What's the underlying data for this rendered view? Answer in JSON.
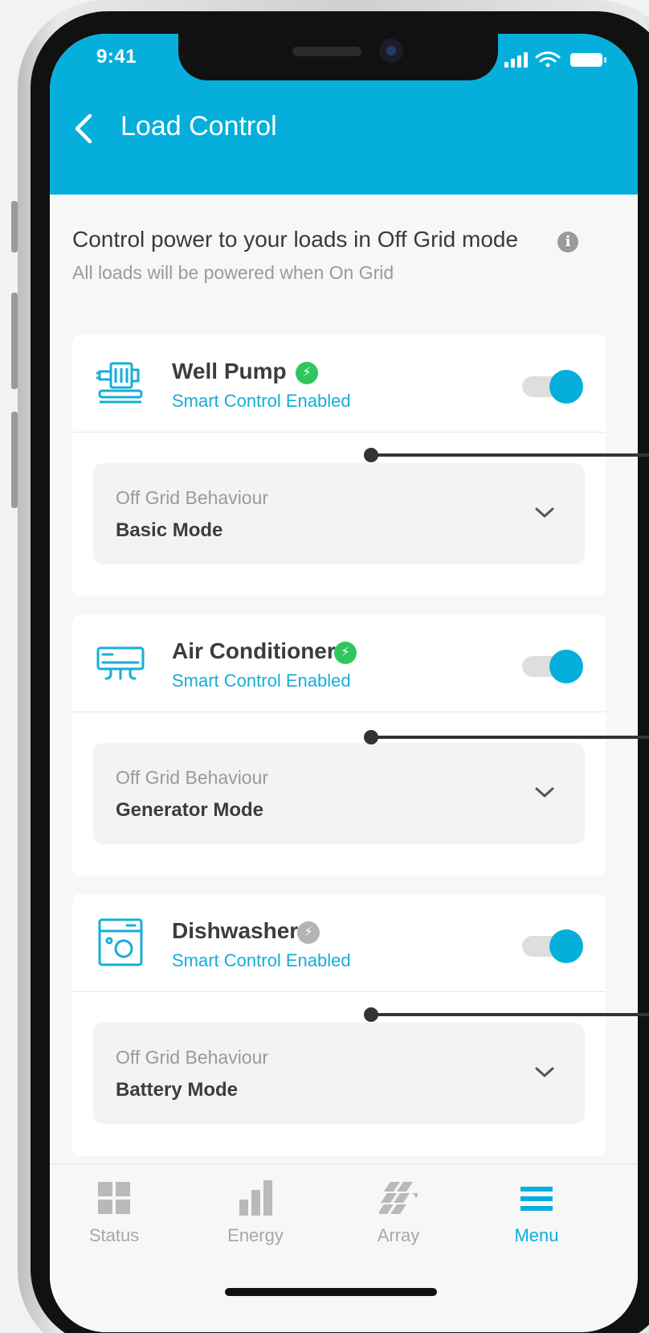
{
  "status_bar": {
    "time": "9:41"
  },
  "header": {
    "title": "Load Control"
  },
  "intro": {
    "title": "Control power to your loads in Off Grid mode",
    "subtitle": "All loads will be powered when On Grid"
  },
  "loads": [
    {
      "name": "Well Pump",
      "icon": "well-pump-icon",
      "smart_badge_color": "#2fc75d",
      "smart_label": "Smart Control Enabled",
      "toggle_on": true,
      "behaviour_label": "Off Grid Behaviour",
      "behaviour_value": "Basic Mode"
    },
    {
      "name": "Air Conditioner",
      "icon": "air-conditioner-icon",
      "smart_badge_color": "#2fc75d",
      "smart_label": "Smart Control Enabled",
      "toggle_on": true,
      "behaviour_label": "Off Grid Behaviour",
      "behaviour_value": "Generator Mode"
    },
    {
      "name": "Dishwasher",
      "icon": "dishwasher-icon",
      "smart_badge_color": "#b3b3b3",
      "smart_label": "Smart Control Enabled",
      "toggle_on": true,
      "behaviour_label": "Off Grid Behaviour",
      "behaviour_value": "Battery Mode"
    }
  ],
  "bottom_nav": [
    {
      "label": "Status",
      "icon": "status-grid-icon",
      "active": false
    },
    {
      "label": "Energy",
      "icon": "energy-bars-icon",
      "active": false
    },
    {
      "label": "Array",
      "icon": "array-panels-icon",
      "active": false
    },
    {
      "label": "Menu",
      "icon": "menu-icon",
      "active": true
    }
  ],
  "colors": {
    "accent": "#06afdb",
    "smart_enabled": "#2fc75d",
    "smart_disabled": "#b3b3b3"
  }
}
